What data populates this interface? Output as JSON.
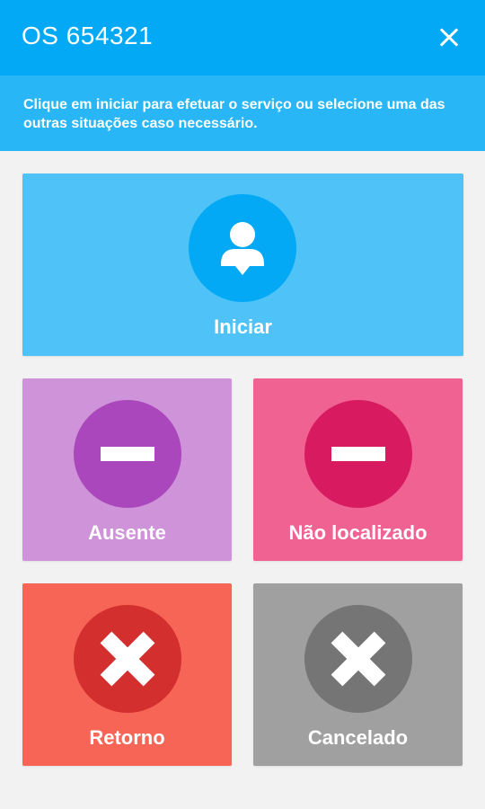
{
  "header": {
    "title": "OS 654321",
    "close_icon": "close-icon"
  },
  "banner": {
    "text": "Clique em iniciar para efetuar o serviço ou selecione uma das outras situações caso necessário."
  },
  "actions": {
    "iniciar": {
      "label": "Iniciar",
      "icon": "person-icon"
    },
    "ausente": {
      "label": "Ausente",
      "icon": "minus-icon"
    },
    "nao_localizado": {
      "label": "Não localizado",
      "icon": "minus-icon"
    },
    "retorno": {
      "label": "Retorno",
      "icon": "x-icon"
    },
    "cancelado": {
      "label": "Cancelado",
      "icon": "x-icon"
    }
  },
  "colors": {
    "appbar": "#03a9f4",
    "banner": "#29b6f6",
    "iniciar_card": "#4fc3f7",
    "ausente_card": "#ce93d8",
    "nao_localizado_card": "#f06292",
    "retorno_card": "#f66555",
    "cancelado_card": "#a0a0a0"
  }
}
